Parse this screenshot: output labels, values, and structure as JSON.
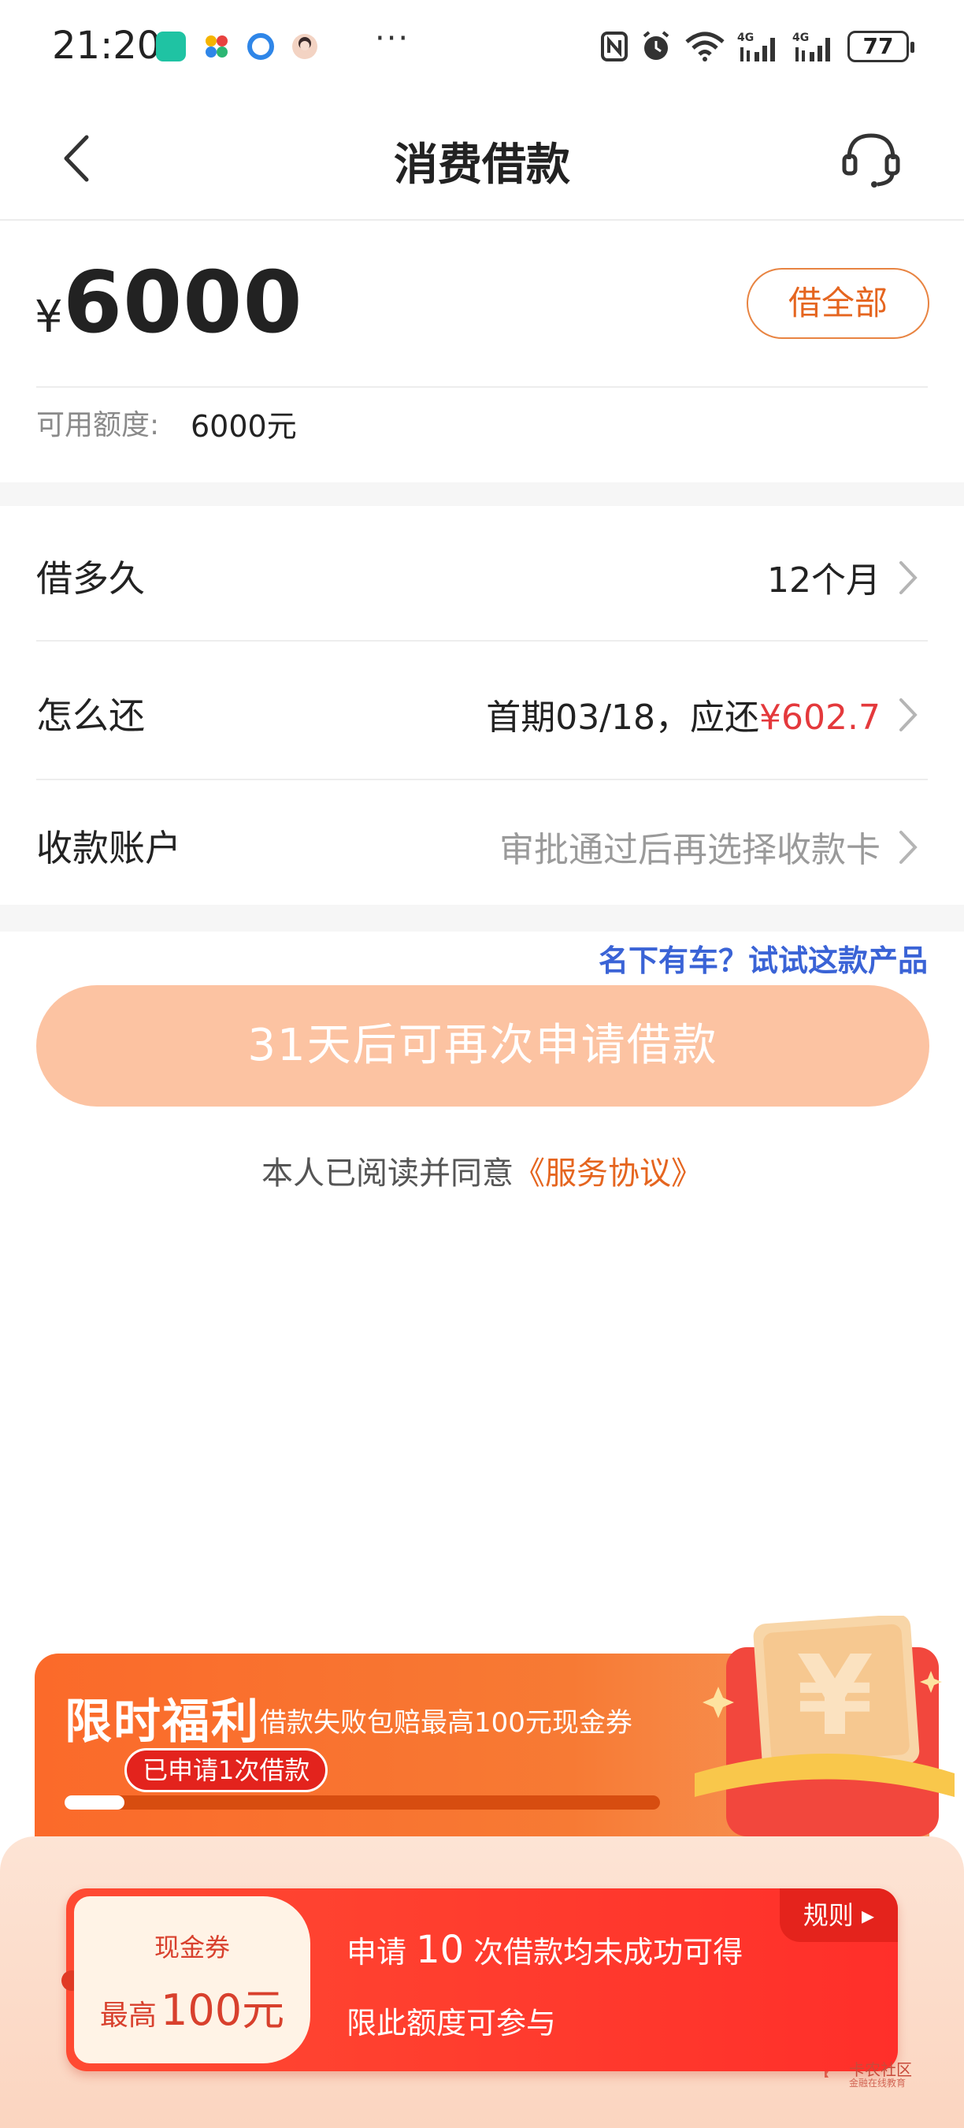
{
  "status_bar": {
    "time": "21:20",
    "dots": "···",
    "battery": "77",
    "icons": [
      "nfc-icon",
      "alarm-icon",
      "wifi-icon",
      "signal-4g-icon",
      "signal-4g-icon",
      "battery-icon"
    ]
  },
  "nav": {
    "title": "消费借款",
    "back_icon": "chevron-left-icon",
    "service_icon": "customer-service-headset-icon"
  },
  "amount": {
    "currency": "¥",
    "value": "6000",
    "borrow_all": "借全部",
    "quota_label": "可用额度:",
    "quota_value": "6000元"
  },
  "rows": {
    "term": {
      "label": "借多久",
      "value": "12个月"
    },
    "repay": {
      "label": "怎么还",
      "value_prefix": "首期03/18，应还",
      "value_amount": "¥602.7"
    },
    "account": {
      "label": "收款账户",
      "value": "审批通过后再选择收款卡"
    }
  },
  "promo_link": "名下有车？试试这款产品",
  "apply_button": "31天后可再次申请借款",
  "agreement": {
    "text": "本人已阅读并同意",
    "link": "《服务协议》"
  },
  "welfare": {
    "title": "限时福利",
    "subtitle": "借款失败包赔最高100元现金券",
    "badge": "已申请1次借款",
    "progress": 0.1
  },
  "coupon": {
    "stub_label": "现金券",
    "stub_prefix": "最高",
    "stub_value": "100元",
    "line1_a": "申请",
    "line1_num": "10",
    "line1_b": "次借款均未成功可得",
    "line2": "限此额度可参与",
    "rules": "规则 ▸"
  },
  "watermark": {
    "text": "卡农社区",
    "sub": "金融在线教育"
  },
  "colors": {
    "accent": "#e5651f",
    "red": "#e4393c",
    "link_blue": "#3a63d6",
    "button_disabled": "#fcc3a2"
  }
}
